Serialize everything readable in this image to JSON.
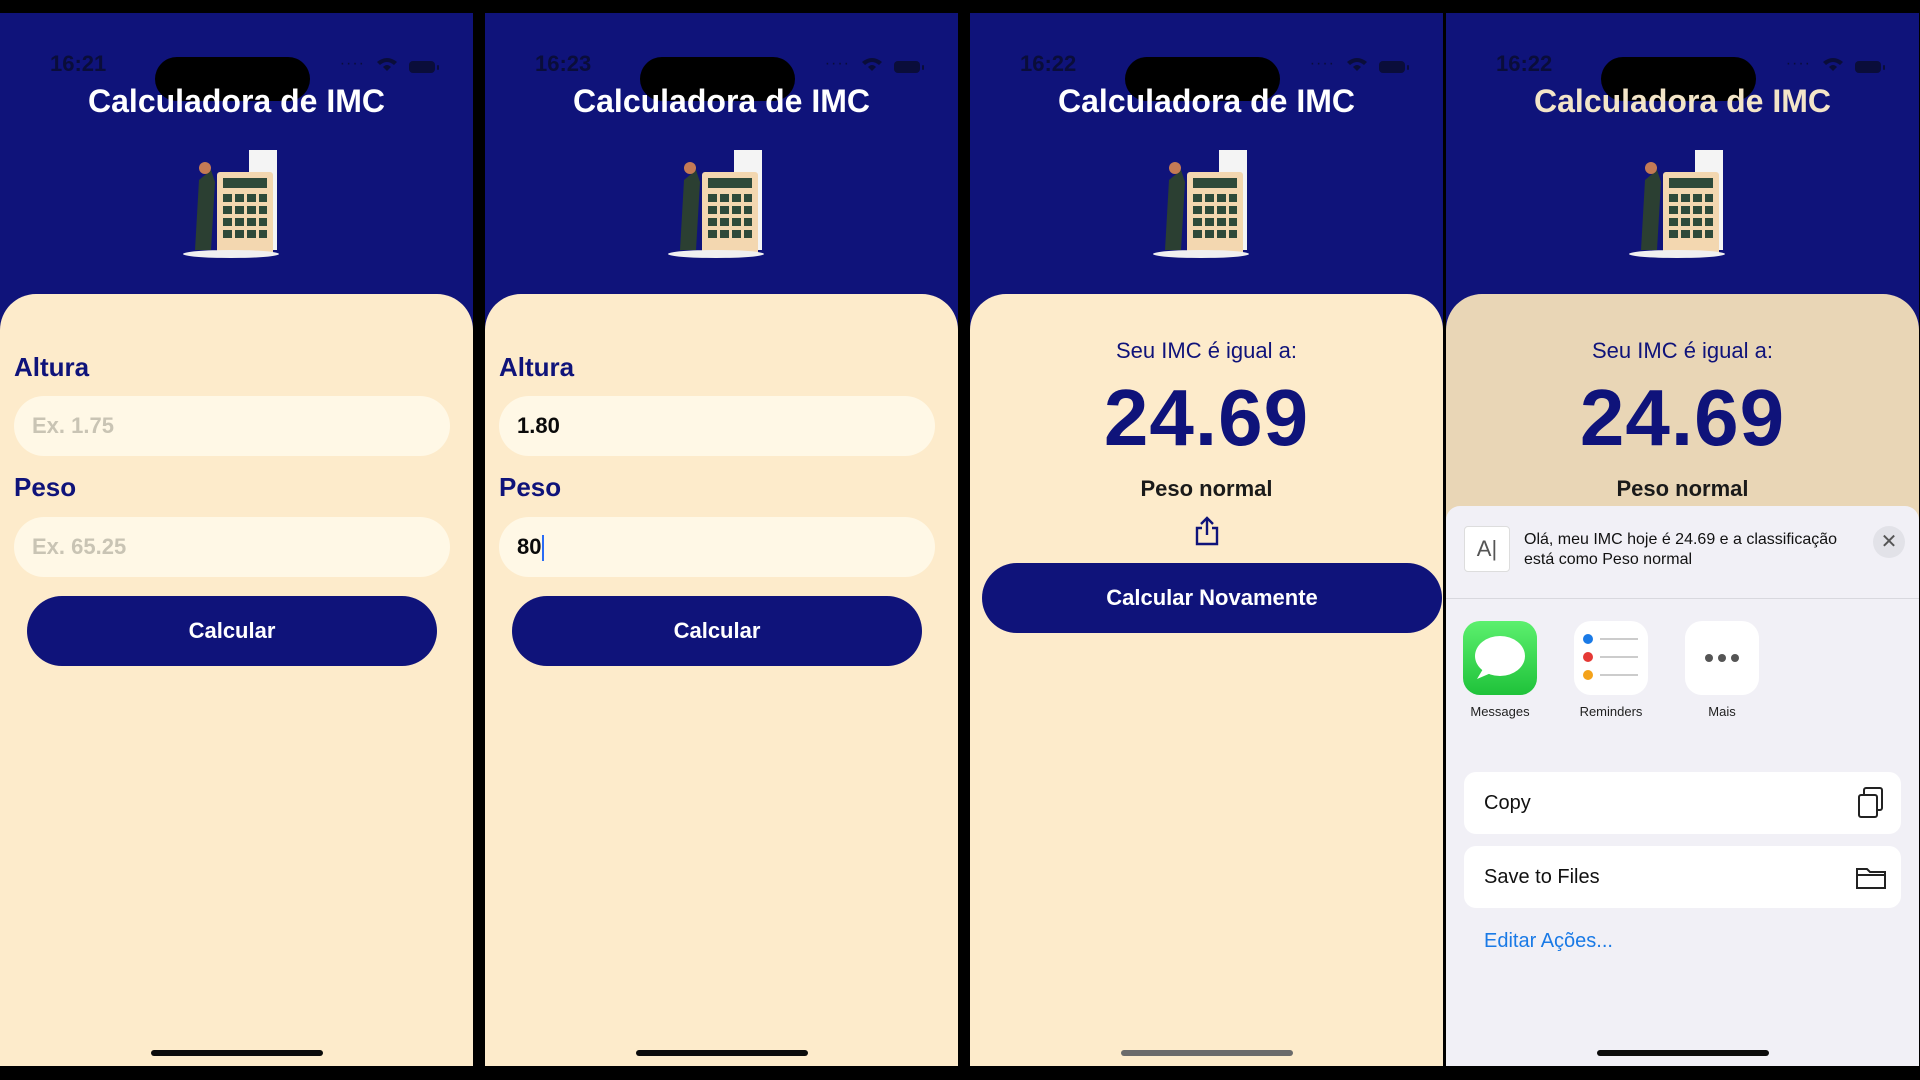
{
  "app": {
    "title": "Calculadora de IMC"
  },
  "screens": [
    {
      "time": "16:21",
      "form": {
        "altura_label": "Altura",
        "altura_placeholder": "Ex. 1.75",
        "peso_label": "Peso",
        "peso_placeholder": "Ex. 65.25",
        "button": "Calcular"
      }
    },
    {
      "time": "16:23",
      "form": {
        "altura_label": "Altura",
        "altura_value": "1.80",
        "peso_label": "Peso",
        "peso_value": "80",
        "button": "Calcular"
      }
    },
    {
      "time": "16:22",
      "result": {
        "label": "Seu IMC é igual a:",
        "value": "24.69",
        "classification": "Peso normal",
        "button": "Calcular Novamente"
      }
    },
    {
      "time": "16:22",
      "result": {
        "label": "Seu IMC é igual a:",
        "value": "24.69",
        "classification": "Peso normal"
      },
      "share_sheet": {
        "preview_text": "Olá, meu IMC hoje é 24.69 e a classificação está como Peso normal",
        "apps": [
          {
            "label": "Messages",
            "icon": "messages-icon"
          },
          {
            "label": "Reminders",
            "icon": "reminders-icon"
          },
          {
            "label": "Mais",
            "icon": "more-icon"
          }
        ],
        "actions": [
          {
            "label": "Copy",
            "icon": "copy-icon"
          },
          {
            "label": "Save to Files",
            "icon": "folder-icon"
          }
        ],
        "edit_actions": "Editar Ações..."
      }
    }
  ],
  "colors": {
    "navy": "#0f137a",
    "cream": "#fdebcb",
    "field": "#fff8e6",
    "link": "#1a7ae6"
  }
}
